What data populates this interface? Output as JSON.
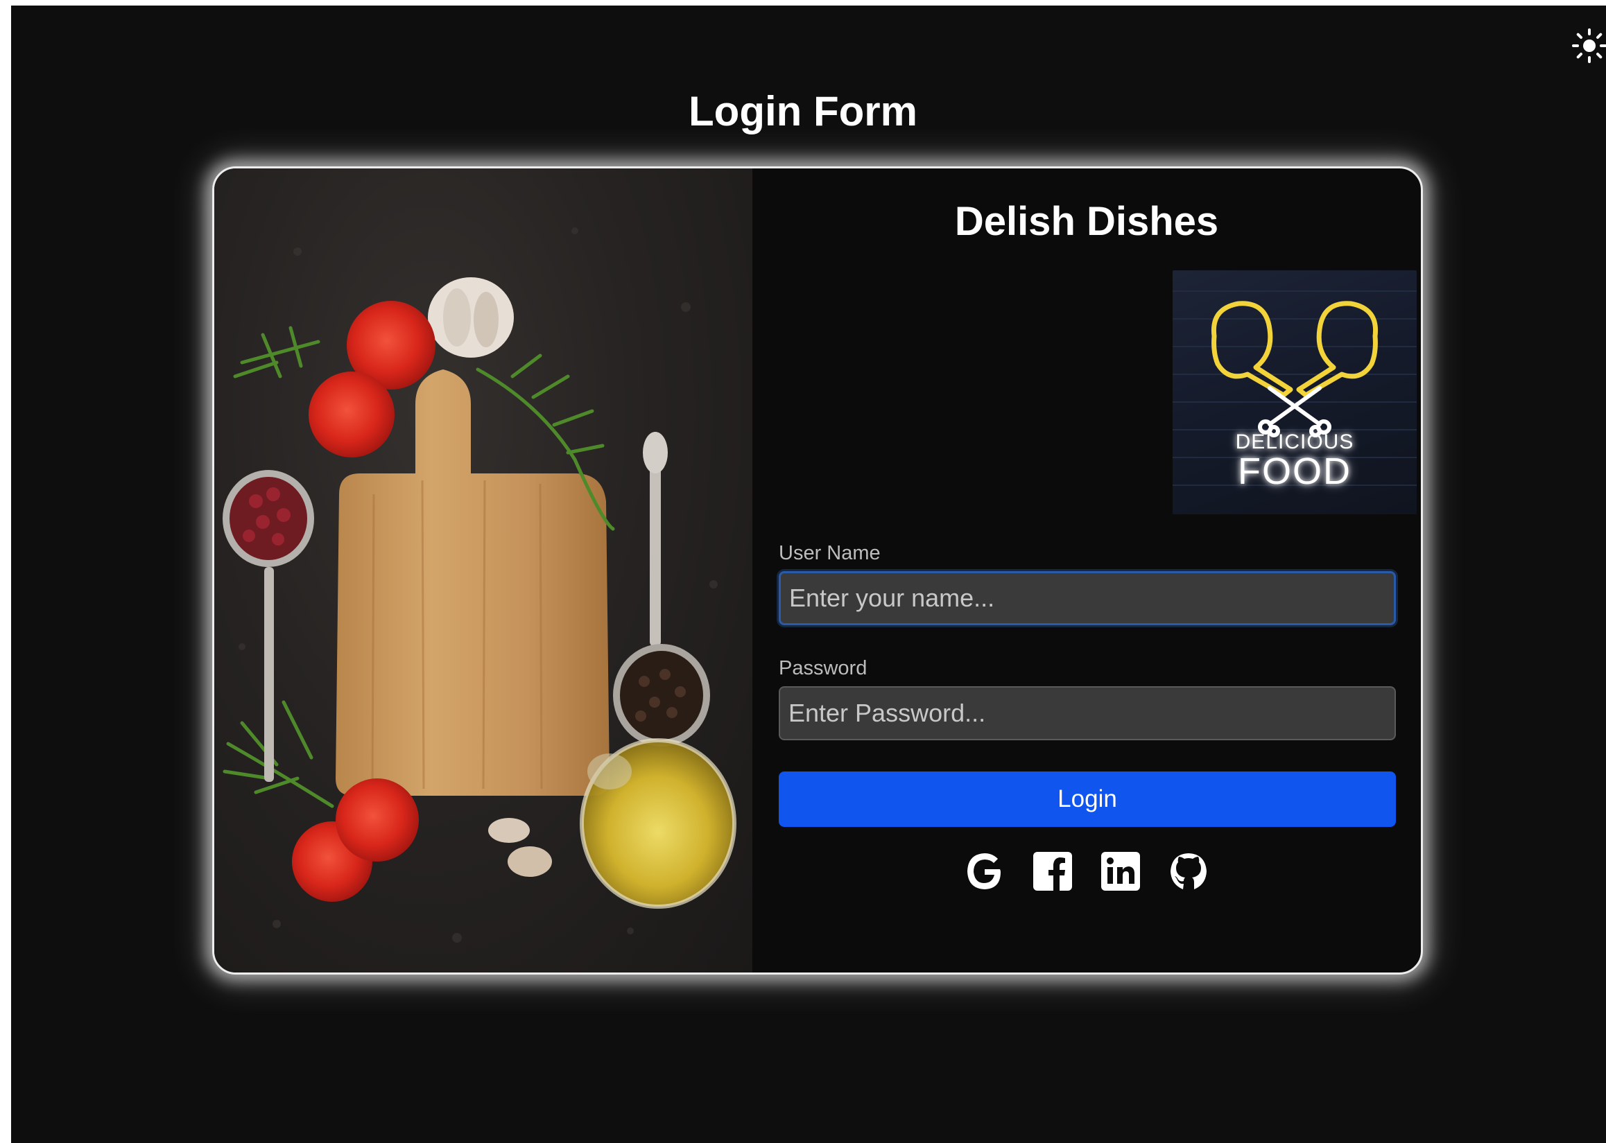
{
  "page": {
    "title": "Login Form",
    "theme_toggle_icon": "sun-icon"
  },
  "brand": {
    "name": "Delish Dishes",
    "logo_text_line1": "DELICIOUS",
    "logo_text_line2": "FOOD"
  },
  "form": {
    "username": {
      "label": "User Name",
      "placeholder": "Enter your name...",
      "value": ""
    },
    "password": {
      "label": "Password",
      "placeholder": "Enter Password...",
      "value": ""
    },
    "submit_label": "Login"
  },
  "social_icons": [
    "google-icon",
    "facebook-icon",
    "linkedin-icon",
    "github-icon"
  ],
  "colors": {
    "background": "#0e0e0e",
    "card_border": "#ededed",
    "input_background": "#3a3a3a",
    "focus_border": "#2a5ba8",
    "primary_button": "#0f55ee",
    "logo_neon": "#f3d33a"
  }
}
